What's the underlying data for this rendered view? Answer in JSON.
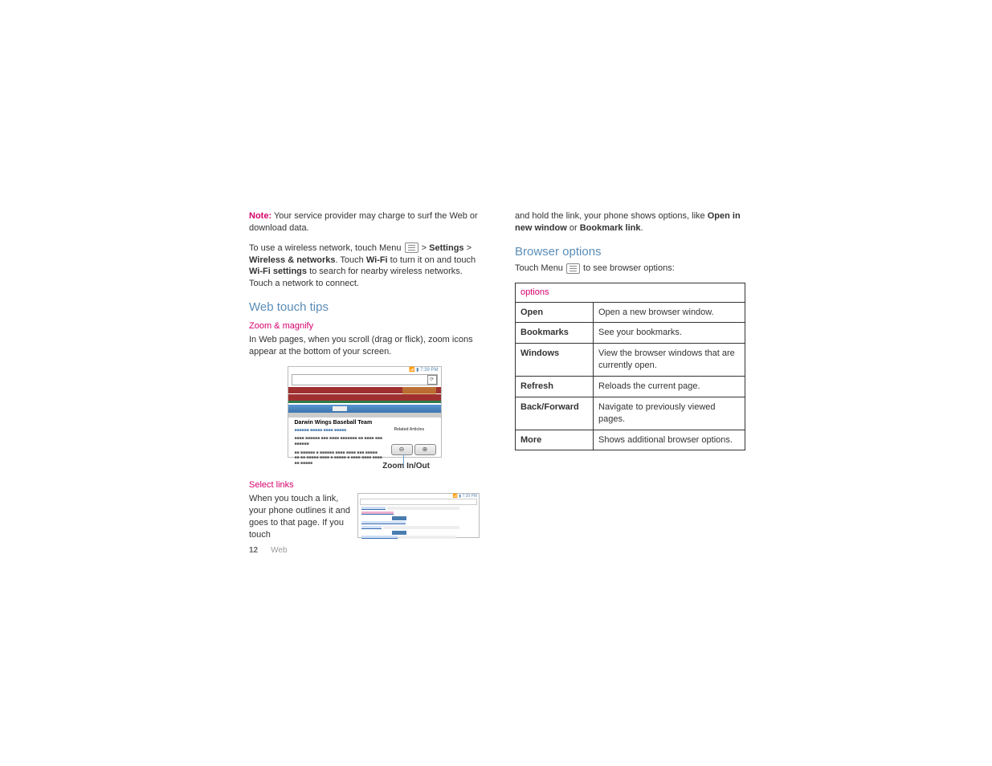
{
  "col1": {
    "note_label": "Note:",
    "note_text": " Your service provider may charge to surf the Web or download data.",
    "wireless_p1a": "To use a wireless network, touch Menu ",
    "wireless_p1b": " > ",
    "settings": "Settings",
    "wireless_p1c": " > ",
    "wireless_networks": "Wireless & networks",
    "wireless_p1d": ". Touch ",
    "wifi": "Wi-Fi",
    "wireless_p1e": " to turn it on and touch ",
    "wifi_settings": "Wi-Fi settings",
    "wireless_p1f": " to search for nearby wireless networks. Touch a network to connect.",
    "h2_tips": "Web touch tips",
    "h3_zoom": "Zoom & magnify",
    "zoom_text": "In Web pages, when you scroll (drag or flick), zoom icons appear at the bottom of your screen.",
    "fig1": {
      "status": "7:39 PM",
      "content_title": "Darwin Wings Baseball Team",
      "related": "Related Articles",
      "zoom_minus": "⊖",
      "zoom_plus": "⊕"
    },
    "zoom_label": "Zoom In/Out",
    "h3_links": "Select links",
    "links_text": "When you touch a link, your phone outlines it and goes to that page. If you touch",
    "fig2": {
      "status": "7:39 PM"
    }
  },
  "col2": {
    "cont_a": "and hold the link, your phone shows options, like ",
    "open_new": "Open in new window",
    "cont_b": " or ",
    "bookmark_link": "Bookmark link",
    "cont_c": ".",
    "h2_browser": "Browser options",
    "touch_a": "Touch Menu ",
    "touch_b": " to see browser options:",
    "table": {
      "header": "options",
      "rows": [
        {
          "label": "Open",
          "desc": "Open a new browser window."
        },
        {
          "label": "Bookmarks",
          "desc": "See your bookmarks."
        },
        {
          "label": "Windows",
          "desc": "View the browser windows that are currently open."
        },
        {
          "label": "Refresh",
          "desc": "Reloads the current page."
        },
        {
          "label": "Back/Forward",
          "desc": "Navigate to previously viewed pages."
        },
        {
          "label": "More",
          "desc": "Shows additional browser options."
        }
      ]
    }
  },
  "footer": {
    "page": "12",
    "section": "Web"
  }
}
